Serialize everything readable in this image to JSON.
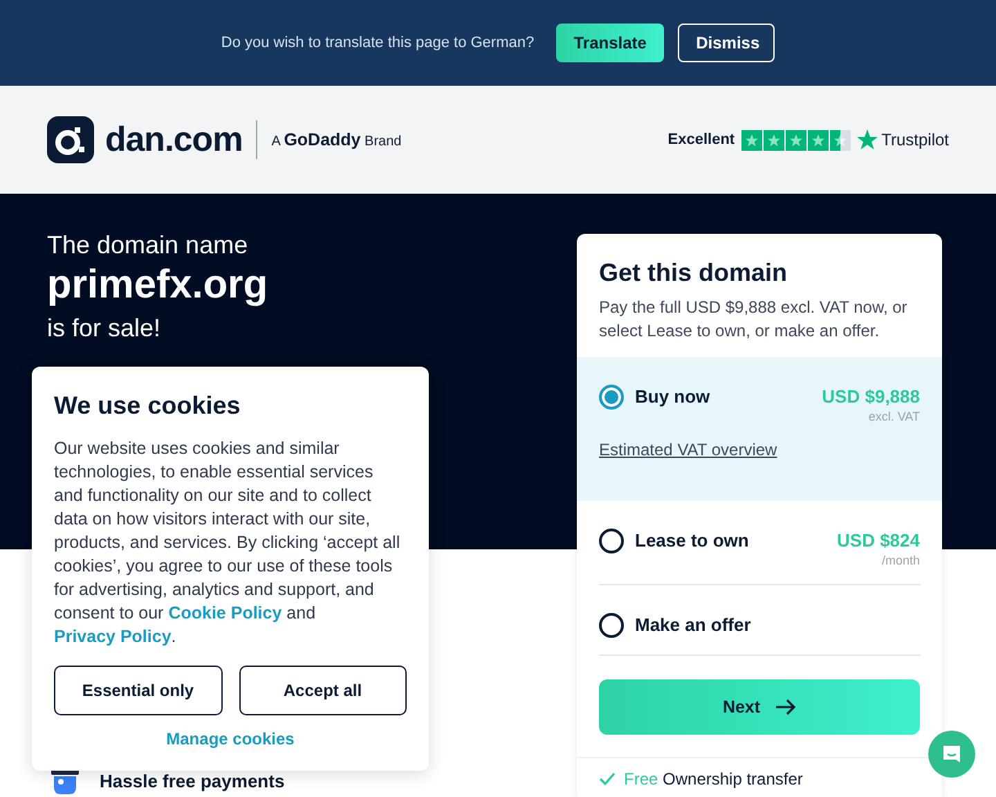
{
  "translate_bar": {
    "message": "Do you wish to translate this page to German?",
    "buttons": [
      {
        "label": "Translate",
        "kind": "primary"
      },
      {
        "label": "Dismiss",
        "kind": "outline"
      }
    ]
  },
  "header": {
    "logo_text": "dan.com",
    "brand_prefix": "A",
    "brand_name": "GoDaddy",
    "brand_suffix": "Brand",
    "rating": {
      "label": "Excellent",
      "stars": 4.5,
      "provider": "Trustpilot"
    }
  },
  "hero": {
    "intro": "The domain name",
    "domain": "primefx.org",
    "outro": "is for sale!"
  },
  "features": [
    {
      "label": "Hassle free payments"
    }
  ],
  "purchase_card": {
    "title": "Get this domain",
    "description": "Pay the full USD $9,888 excl. VAT now, or select Lease to own, or make an offer.",
    "options": [
      {
        "label": "Buy now",
        "selected": true,
        "price": "USD $9,888",
        "price_note": "excl. VAT",
        "link": "Estimated VAT overview"
      },
      {
        "label": "Lease to own",
        "selected": false,
        "price": "USD $824",
        "price_note": "/month"
      },
      {
        "label": "Make an offer",
        "selected": false
      }
    ],
    "next_button": "Next",
    "perks": [
      {
        "highlight": "Free",
        "text": "Ownership transfer"
      }
    ]
  },
  "cookie_dialog": {
    "title": "We use cookies",
    "body_before": "Our website uses cookies and similar technologies, to enable essential services and functionality on our site and to collect data on how visitors interact with our site, products, and services. By clicking ‘accept all cookies’, you agree to our use of these tools for advertising, analytics and support, and consent to our",
    "link_1": "Cookie Policy",
    "body_between": "and",
    "link_2": "Privacy Policy",
    "body_after": ".",
    "buttons": [
      "Essential only",
      "Accept all"
    ],
    "manage_link": "Manage cookies"
  }
}
